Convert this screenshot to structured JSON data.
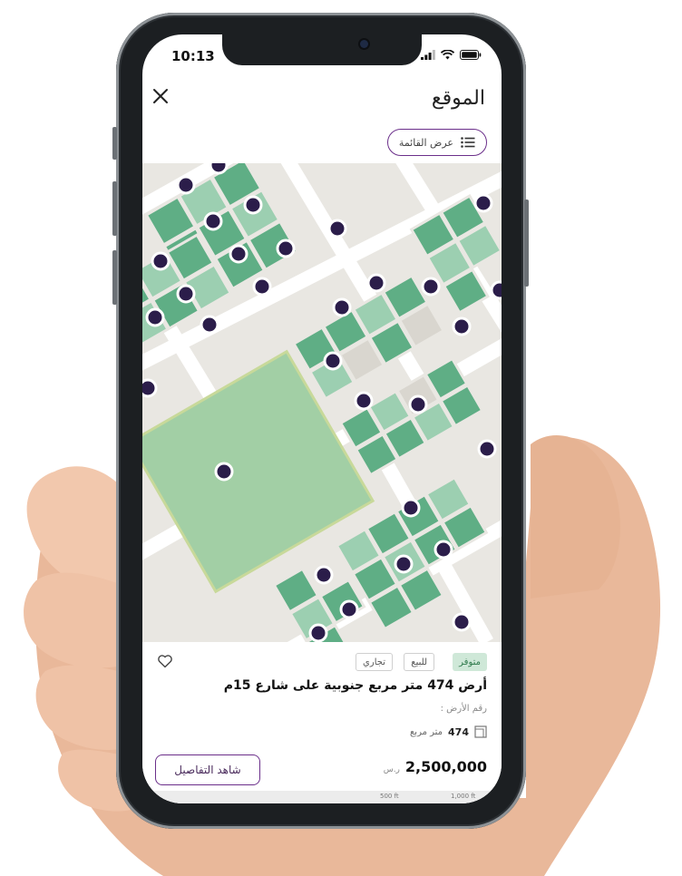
{
  "status_bar": {
    "time": "10:13"
  },
  "header": {
    "title": "الموقع",
    "close_icon": "close-icon"
  },
  "list_view": {
    "label": "عرض القائمة",
    "icon": "list-icon"
  },
  "listing": {
    "tags": {
      "available": "متوفر",
      "for_sale": "للبيع",
      "commercial": "تجاري"
    },
    "title": "أرض 474 متر مربع جنوبية على شارع 15م",
    "plot_number_label": "رقم الأرض :",
    "area_value": "474",
    "area_unit": "متر مربع",
    "price": "2,500,000",
    "currency": "ر.س",
    "details_button": "شاهد التفاصيل"
  },
  "map_scale": {
    "labels": [
      "500 ft",
      "1,000 ft"
    ]
  },
  "colors": {
    "accent": "#6b2f8a",
    "map_green_dark": "#5fae85",
    "map_green_light": "#9ccfb1",
    "marker": "#2b1d4a",
    "available_tag": "#cfe8d8"
  }
}
